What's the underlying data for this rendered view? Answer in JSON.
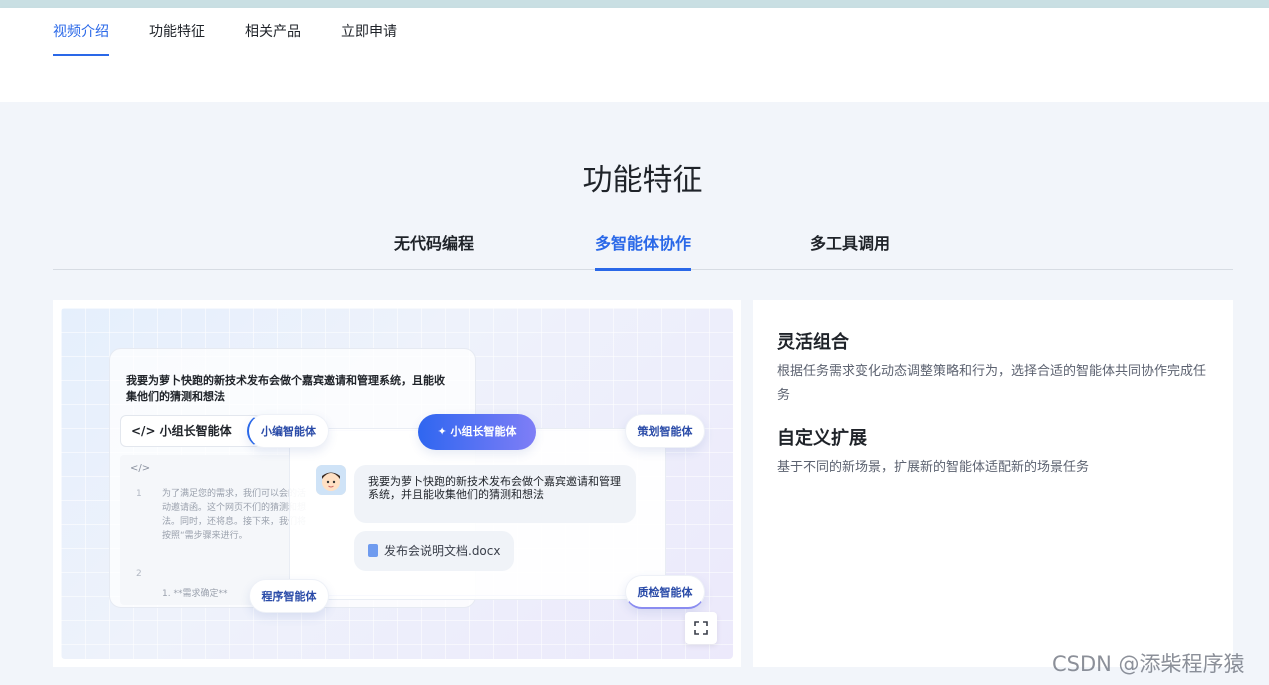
{
  "nav": {
    "items": [
      {
        "label": "视频介绍",
        "active": true
      },
      {
        "label": "功能特征",
        "active": false
      },
      {
        "label": "相关产品",
        "active": false
      },
      {
        "label": "立即申请",
        "active": false
      }
    ]
  },
  "section": {
    "title": "功能特征"
  },
  "tabs": [
    {
      "label": "无代码编程",
      "active": false
    },
    {
      "label": "多智能体协作",
      "active": true
    },
    {
      "label": "多工具调用",
      "active": false
    }
  ],
  "demo": {
    "doc_title": "我要为萝卜快跑的新技术发布会做个嘉宾邀请和管理系统，且能收集他们的猜测和想法",
    "doc_tag": "</> 小组长智能体",
    "code_header": "</>",
    "code_lines": [
      {
        "no": "1",
        "text": "为了满足您的需求，我们可以会的活动邀请函。这个网页不们的猜测和想法。同时，还将息。接下来，我们将按照“需步骤来进行。"
      },
      {
        "no": "2",
        "text": ""
      },
      {
        "no": "",
        "text": "1. **需求确定**"
      }
    ],
    "chat_message": "我要为萝卜快跑的新技术发布会做个嘉宾邀请和管理系统，并且能收集他们的猜测和想法",
    "file_name": "发布会说明文档.docx",
    "agents": {
      "editor": "小编智能体",
      "lead": "小组长智能体",
      "planner": "策划智能体",
      "programmer": "程序智能体",
      "qa": "质检智能体"
    }
  },
  "features": [
    {
      "title": "灵活组合",
      "desc": "根据任务需求变化动态调整策略和行为，选择合适的智能体共同协作完成任务"
    },
    {
      "title": "自定义扩展",
      "desc": "基于不同的新场景，扩展新的智能体适配新的场景任务"
    }
  ],
  "watermark": "CSDN @添柴程序猿",
  "colors": {
    "accent": "#2a68e8",
    "background": "#f2f5fa"
  }
}
